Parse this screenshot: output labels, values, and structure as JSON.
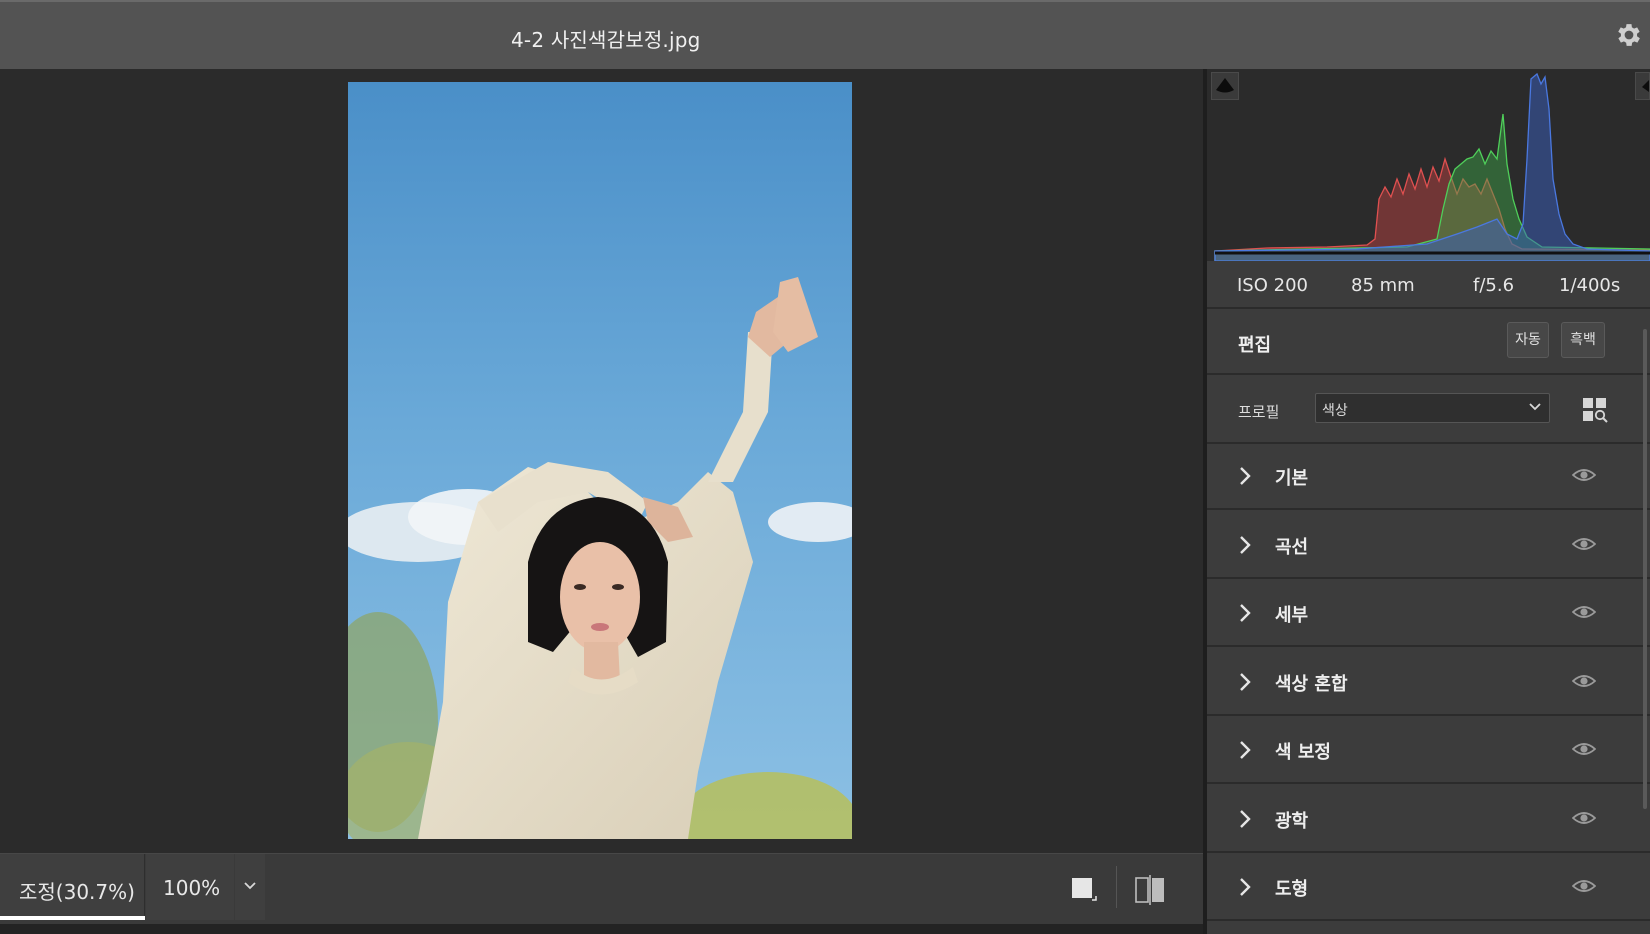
{
  "window": {
    "title": "4-2 사진색감보정.jpg"
  },
  "histogram": {
    "clip_shadow_icon": "shadow-clipping-triangle-icon",
    "clip_highlight_icon": "highlight-clipping-triangle-icon",
    "channel_colors": {
      "red": "#e04a4a",
      "green": "#4fcf5a",
      "blue": "#4a78e0"
    }
  },
  "exif": {
    "iso": "ISO 200",
    "focal": "85 mm",
    "aperture": "f/5.6",
    "shutter": "1/400s"
  },
  "edit": {
    "label": "편집",
    "auto_label": "자동",
    "bw_label": "흑백"
  },
  "profile": {
    "label": "프로필",
    "value": "색상",
    "browse_icon": "profile-browser-grid-icon"
  },
  "sections": [
    {
      "id": "basic",
      "label": "기본"
    },
    {
      "id": "curve",
      "label": "곡선"
    },
    {
      "id": "detail",
      "label": "세부"
    },
    {
      "id": "color-mixer",
      "label": "색상 혼합"
    },
    {
      "id": "color-grading",
      "label": "색 보정"
    },
    {
      "id": "optics",
      "label": "광학"
    },
    {
      "id": "geometry",
      "label": "도형"
    }
  ],
  "bottombar": {
    "fit_label": "조정(30.7%)",
    "zoom_label": "100%"
  }
}
